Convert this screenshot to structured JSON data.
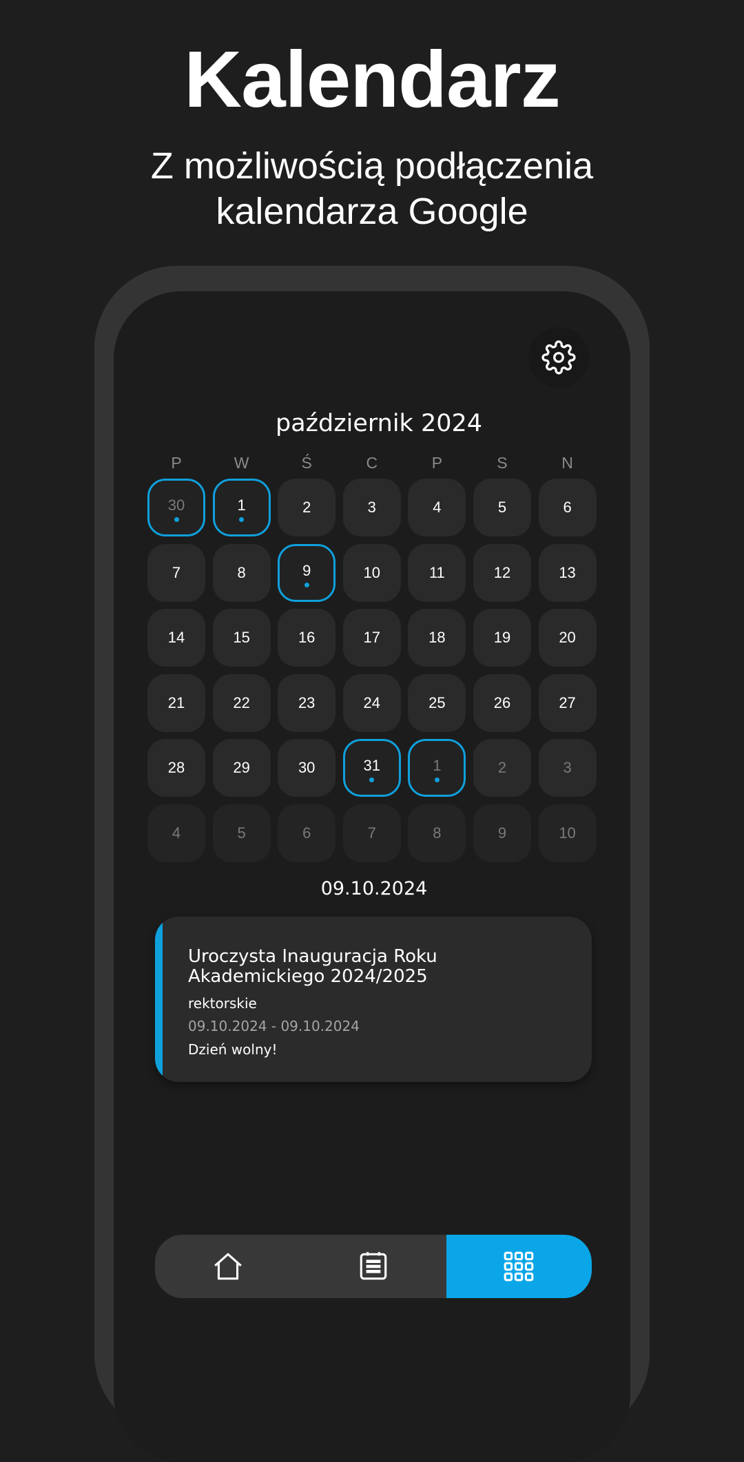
{
  "header": {
    "title": "Kalendarz",
    "subtitle_line1": "Z możliwością podłączenia",
    "subtitle_line2": "kalendarza Google"
  },
  "colors": {
    "background": "#1e1e1e",
    "screen": "#1c1c1c",
    "day_cell": "#2a2a2a",
    "accent": "#0fa0dc",
    "nav_active": "#0aa6e8"
  },
  "settings": {
    "icon": "gear-icon"
  },
  "calendar": {
    "month_title": "październik 2024",
    "weekdays": [
      "P",
      "W",
      "Ś",
      "C",
      "P",
      "S",
      "N"
    ],
    "days": [
      {
        "label": "30",
        "dim": true,
        "selected": true,
        "dot": true,
        "next": false
      },
      {
        "label": "1",
        "dim": false,
        "selected": true,
        "dot": true,
        "next": false
      },
      {
        "label": "2",
        "dim": false,
        "selected": false,
        "dot": false,
        "next": false
      },
      {
        "label": "3",
        "dim": false,
        "selected": false,
        "dot": false,
        "next": false
      },
      {
        "label": "4",
        "dim": false,
        "selected": false,
        "dot": false,
        "next": false
      },
      {
        "label": "5",
        "dim": false,
        "selected": false,
        "dot": false,
        "next": false
      },
      {
        "label": "6",
        "dim": false,
        "selected": false,
        "dot": false,
        "next": false
      },
      {
        "label": "7",
        "dim": false,
        "selected": false,
        "dot": false,
        "next": false
      },
      {
        "label": "8",
        "dim": false,
        "selected": false,
        "dot": false,
        "next": false
      },
      {
        "label": "9",
        "dim": false,
        "selected": true,
        "dot": true,
        "next": false
      },
      {
        "label": "10",
        "dim": false,
        "selected": false,
        "dot": false,
        "next": false
      },
      {
        "label": "11",
        "dim": false,
        "selected": false,
        "dot": false,
        "next": false
      },
      {
        "label": "12",
        "dim": false,
        "selected": false,
        "dot": false,
        "next": false
      },
      {
        "label": "13",
        "dim": false,
        "selected": false,
        "dot": false,
        "next": false
      },
      {
        "label": "14",
        "dim": false,
        "selected": false,
        "dot": false,
        "next": false
      },
      {
        "label": "15",
        "dim": false,
        "selected": false,
        "dot": false,
        "next": false
      },
      {
        "label": "16",
        "dim": false,
        "selected": false,
        "dot": false,
        "next": false
      },
      {
        "label": "17",
        "dim": false,
        "selected": false,
        "dot": false,
        "next": false
      },
      {
        "label": "18",
        "dim": false,
        "selected": false,
        "dot": false,
        "next": false
      },
      {
        "label": "19",
        "dim": false,
        "selected": false,
        "dot": false,
        "next": false
      },
      {
        "label": "20",
        "dim": false,
        "selected": false,
        "dot": false,
        "next": false
      },
      {
        "label": "21",
        "dim": false,
        "selected": false,
        "dot": false,
        "next": false
      },
      {
        "label": "22",
        "dim": false,
        "selected": false,
        "dot": false,
        "next": false
      },
      {
        "label": "23",
        "dim": false,
        "selected": false,
        "dot": false,
        "next": false
      },
      {
        "label": "24",
        "dim": false,
        "selected": false,
        "dot": false,
        "next": false
      },
      {
        "label": "25",
        "dim": false,
        "selected": false,
        "dot": false,
        "next": false
      },
      {
        "label": "26",
        "dim": false,
        "selected": false,
        "dot": false,
        "next": false
      },
      {
        "label": "27",
        "dim": false,
        "selected": false,
        "dot": false,
        "next": false
      },
      {
        "label": "28",
        "dim": false,
        "selected": false,
        "dot": false,
        "next": false
      },
      {
        "label": "29",
        "dim": false,
        "selected": false,
        "dot": false,
        "next": false
      },
      {
        "label": "30",
        "dim": false,
        "selected": false,
        "dot": false,
        "next": false
      },
      {
        "label": "31",
        "dim": false,
        "selected": true,
        "dot": true,
        "next": false
      },
      {
        "label": "1",
        "dim": true,
        "selected": true,
        "dot": true,
        "next": false
      },
      {
        "label": "2",
        "dim": true,
        "selected": false,
        "dot": false,
        "next": false
      },
      {
        "label": "3",
        "dim": true,
        "selected": false,
        "dot": false,
        "next": false
      },
      {
        "label": "4",
        "dim": true,
        "selected": false,
        "dot": false,
        "next": true
      },
      {
        "label": "5",
        "dim": true,
        "selected": false,
        "dot": false,
        "next": true
      },
      {
        "label": "6",
        "dim": true,
        "selected": false,
        "dot": false,
        "next": true
      },
      {
        "label": "7",
        "dim": true,
        "selected": false,
        "dot": false,
        "next": true
      },
      {
        "label": "8",
        "dim": true,
        "selected": false,
        "dot": false,
        "next": true
      },
      {
        "label": "9",
        "dim": true,
        "selected": false,
        "dot": false,
        "next": true
      },
      {
        "label": "10",
        "dim": true,
        "selected": false,
        "dot": false,
        "next": true
      }
    ]
  },
  "selected_date": "09.10.2024",
  "event": {
    "title": "Uroczysta Inauguracja Roku Akademickiego 2024/2025",
    "category": "rektorskie",
    "dates": "09.10.2024  -  09.10.2024",
    "note": "Dzień wolny!"
  },
  "nav": {
    "items": [
      {
        "icon": "home-icon",
        "active": false
      },
      {
        "icon": "list-icon",
        "active": false
      },
      {
        "icon": "grid-icon",
        "active": true
      }
    ]
  }
}
